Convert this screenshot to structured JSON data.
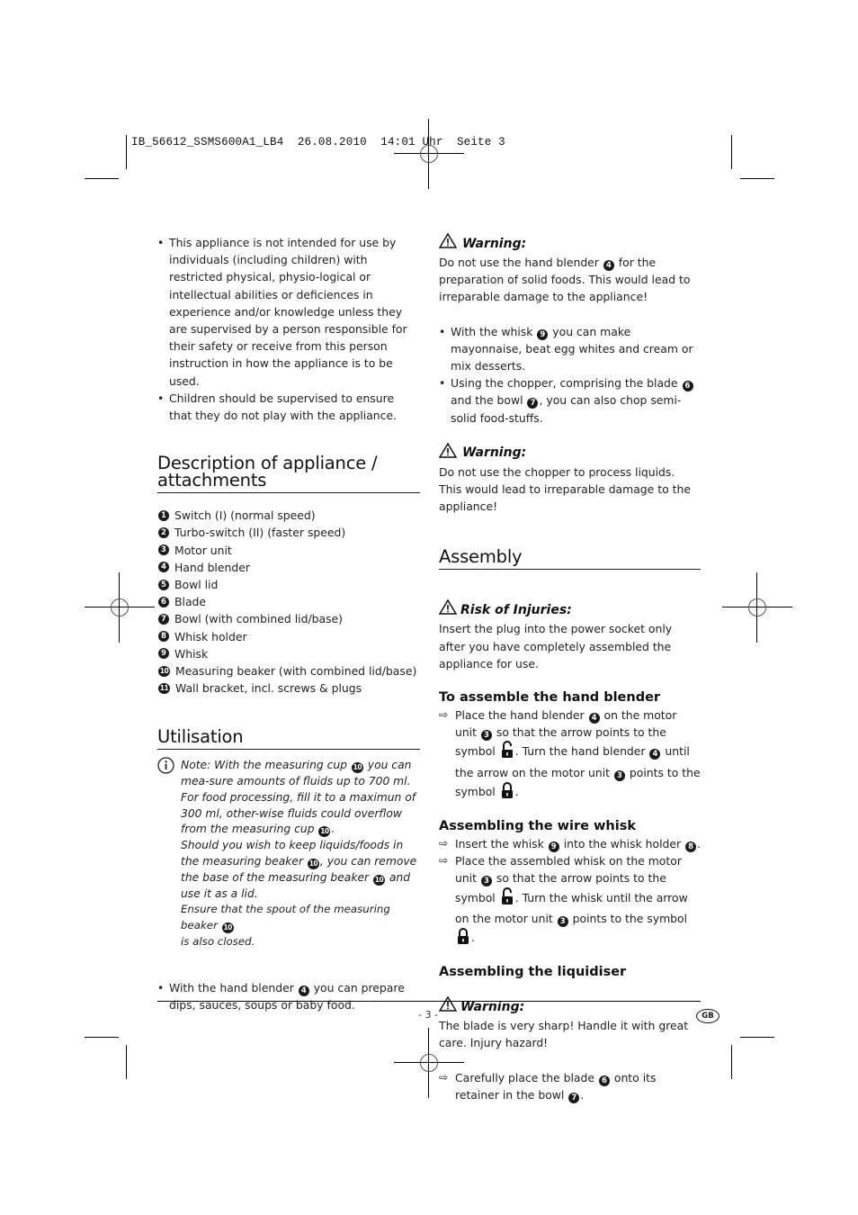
{
  "print_header": "IB_56612_SSMS600A1_LB4  26.08.2010  14:01 Uhr  Seite 3",
  "left": {
    "intro_bullets": [
      "This appliance is not intended for use by individuals (including children) with restricted physical, physio-logical or intellectual abilities or deficiences in experience and/or knowledge unless they are supervised by a person responsible for their safety or receive from this person instruction in how the appliance is to be used.",
      "Children should be supervised to ensure that they do not play with the appliance."
    ],
    "description": {
      "title": "Description of appliance / attachments",
      "items": [
        {
          "num": "1",
          "label": "Switch (I) (normal speed)"
        },
        {
          "num": "2",
          "label": "Turbo-switch (II) (faster speed)"
        },
        {
          "num": "3",
          "label": "Motor unit"
        },
        {
          "num": "4",
          "label": "Hand blender"
        },
        {
          "num": "5",
          "label": "Bowl lid"
        },
        {
          "num": "6",
          "label": "Blade"
        },
        {
          "num": "7",
          "label": "Bowl (with combined lid/base)"
        },
        {
          "num": "8",
          "label": "Whisk holder"
        },
        {
          "num": "9",
          "label": "Whisk"
        },
        {
          "num": "10",
          "label": "Measuring beaker  (with combined lid/base)"
        },
        {
          "num": "11",
          "label": "Wall bracket, incl. screws & plugs"
        }
      ]
    },
    "utilisation": {
      "title": "Utilisation",
      "note_parts": [
        "Note: With the measuring cup ",
        " you can mea-sure amounts of fluids up to 700 ml. For food processing, fill it to a maximun of 300 ml, other-wise fluids could overflow from the measuring cup ",
        ".",
        "Should you wish to keep liquids/foods in the measuring beaker ",
        ", you can remove the base of the measuring beaker ",
        " and use it as a lid.",
        "Ensure that the spout of the measuring beaker ",
        " is also closed."
      ],
      "bullet_parts": [
        "With the hand blender ",
        " you can prepare dips, sauces, soups or baby food."
      ]
    }
  },
  "right": {
    "warning1": {
      "title": "Warning:",
      "parts": [
        "Do not use the hand blender ",
        " for the preparation of solid foods. This would lead to irreparable damage to the appliance!"
      ]
    },
    "bullets": [
      {
        "parts": [
          "With the whisk ",
          " you can make mayonnaise, beat egg whites and cream or mix desserts."
        ]
      },
      {
        "parts": [
          "Using the chopper, comprising the blade ",
          " and the bowl ",
          ", you can also chop semi-solid food-stuffs."
        ]
      }
    ],
    "warning2": {
      "title": "Warning:",
      "text": "Do not use the chopper to process liquids. This would lead to irreparable damage to the appliance!"
    },
    "assembly": {
      "title": "Assembly",
      "risk_title": "Risk of Injuries:",
      "risk_text": "Insert the plug into the power socket only after you have completely assembled the appliance for use.",
      "hand_blender": {
        "title": "To assemble the hand blender",
        "parts": [
          "Place the hand blender ",
          " on the motor unit ",
          " so that the arrow points to the symbol ",
          ". Turn the hand blender ",
          " until the arrow on the motor unit ",
          " points to the symbol ",
          "."
        ]
      },
      "wire_whisk": {
        "title": "Assembling the wire whisk",
        "step1_parts": [
          "Insert the whisk ",
          " into the whisk holder ",
          "."
        ],
        "step2_parts": [
          "Place the assembled whisk on the motor unit ",
          " so that the arrow points to the symbol ",
          ". Turn the whisk until the arrow on the motor unit ",
          " points to the symbol ",
          "."
        ]
      },
      "liquidiser": {
        "title": "Assembling the liquidiser",
        "warning_title": "Warning:",
        "warning_text": "The blade is very sharp! Handle it with great care. Injury hazard!",
        "step_parts": [
          "Carefully place the blade ",
          " onto its retainer in the bowl ",
          "."
        ]
      }
    }
  },
  "footer": {
    "page_number": "- 3 -",
    "language_badge": "GB"
  },
  "icons": {
    "arrow": "⇨",
    "unlock": "unlocked-padlock-icon",
    "lock": "locked-padlock-icon",
    "warning": "warning-triangle-icon",
    "info": "info-circle-icon"
  }
}
